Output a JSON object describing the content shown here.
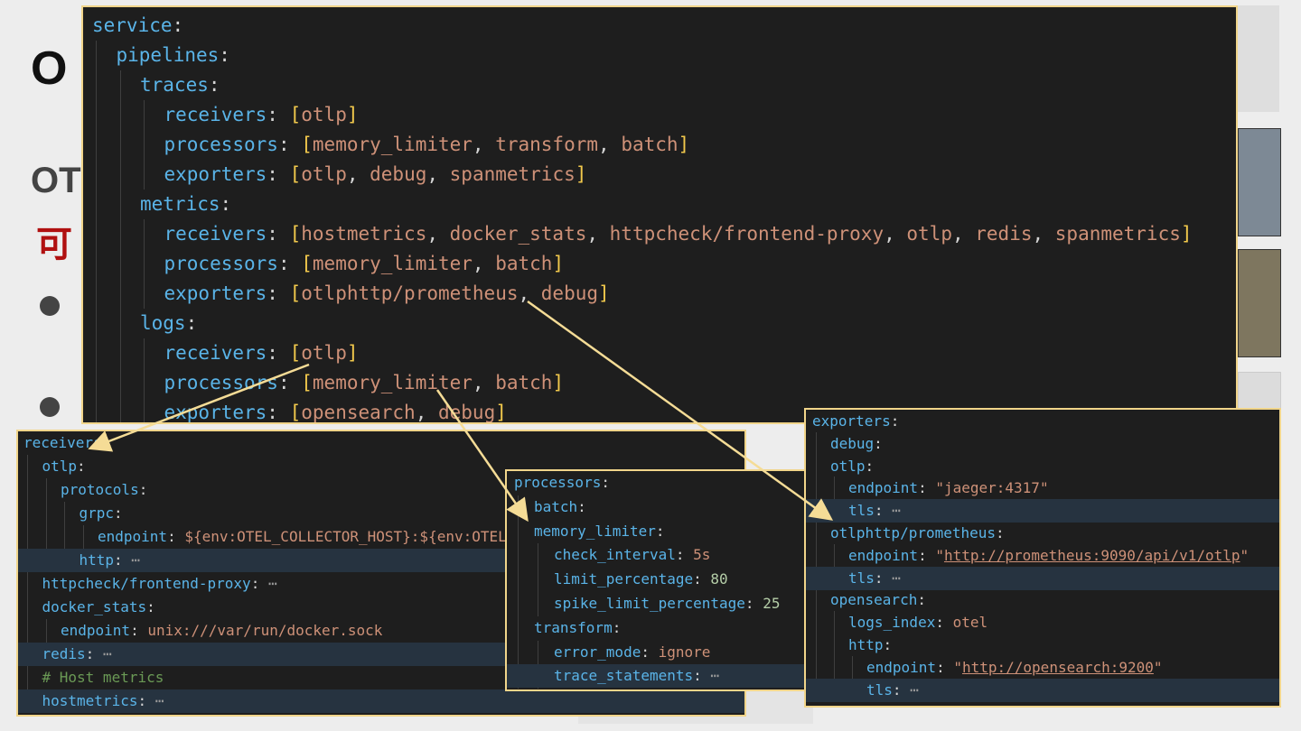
{
  "slide": {
    "title": "O",
    "subtitle_line1": "OT",
    "subtitle_line2": "可"
  },
  "main_config": {
    "lines": [
      {
        "indent": 0,
        "key": "service",
        "tail": ""
      },
      {
        "indent": 1,
        "key": "pipelines",
        "tail": ""
      },
      {
        "indent": 2,
        "key": "traces",
        "tail": ""
      },
      {
        "indent": 3,
        "key": "receivers",
        "items": [
          "otlp"
        ]
      },
      {
        "indent": 3,
        "key": "processors",
        "items": [
          "memory_limiter",
          "transform",
          "batch"
        ]
      },
      {
        "indent": 3,
        "key": "exporters",
        "items": [
          "otlp",
          "debug",
          "spanmetrics"
        ]
      },
      {
        "indent": 2,
        "key": "metrics",
        "tail": ""
      },
      {
        "indent": 3,
        "key": "receivers",
        "items": [
          "hostmetrics",
          "docker_stats",
          "httpcheck/frontend-proxy",
          "otlp",
          "redis",
          "spanmetrics"
        ]
      },
      {
        "indent": 3,
        "key": "processors",
        "items": [
          "memory_limiter",
          "batch"
        ]
      },
      {
        "indent": 3,
        "key": "exporters",
        "items": [
          "otlphttp/prometheus",
          "debug"
        ]
      },
      {
        "indent": 2,
        "key": "logs",
        "tail": ""
      },
      {
        "indent": 3,
        "key": "receivers",
        "items": [
          "otlp"
        ]
      },
      {
        "indent": 3,
        "key": "processors",
        "items": [
          "memory_limiter",
          "batch"
        ]
      },
      {
        "indent": 3,
        "key": "exporters",
        "items": [
          "opensearch",
          "debug"
        ]
      }
    ]
  },
  "receivers_config": {
    "lines": [
      {
        "indent": 0,
        "key": "receivers"
      },
      {
        "indent": 1,
        "key": "otlp"
      },
      {
        "indent": 2,
        "key": "protocols"
      },
      {
        "indent": 3,
        "key": "grpc"
      },
      {
        "indent": 4,
        "key": "endpoint",
        "value": "${env:OTEL_COLLECTOR_HOST}:${env:OTEL_COLLECTOR_PORT_GRPC}",
        "vtype": "v"
      },
      {
        "indent": 3,
        "key": "http",
        "folded": true,
        "hl": true
      },
      {
        "indent": 1,
        "key": "httpcheck/frontend-proxy",
        "folded": true
      },
      {
        "indent": 1,
        "key": "docker_stats"
      },
      {
        "indent": 2,
        "key": "endpoint",
        "value": "unix:///var/run/docker.sock",
        "vtype": "v"
      },
      {
        "indent": 1,
        "key": "redis",
        "folded": true,
        "hl": true
      },
      {
        "indent": 1,
        "comment": "# Host metrics"
      },
      {
        "indent": 1,
        "key": "hostmetrics",
        "folded": true,
        "hl": true
      }
    ]
  },
  "processors_config": {
    "lines": [
      {
        "indent": 0,
        "key": "processors"
      },
      {
        "indent": 1,
        "key": "batch"
      },
      {
        "indent": 1,
        "key": "memory_limiter"
      },
      {
        "indent": 2,
        "key": "check_interval",
        "value": "5s",
        "vtype": "v"
      },
      {
        "indent": 2,
        "key": "limit_percentage",
        "value": "80",
        "vtype": "n"
      },
      {
        "indent": 2,
        "key": "spike_limit_percentage",
        "value": "25",
        "vtype": "n"
      },
      {
        "indent": 1,
        "key": "transform"
      },
      {
        "indent": 2,
        "key": "error_mode",
        "value": "ignore",
        "vtype": "v"
      },
      {
        "indent": 2,
        "key": "trace_statements",
        "folded": true,
        "hl": true
      }
    ]
  },
  "exporters_config": {
    "lines": [
      {
        "indent": 0,
        "key": "exporters"
      },
      {
        "indent": 1,
        "key": "debug"
      },
      {
        "indent": 1,
        "key": "otlp"
      },
      {
        "indent": 2,
        "key": "endpoint",
        "value": "\"jaeger:4317\"",
        "vtype": "v"
      },
      {
        "indent": 2,
        "key": "tls",
        "folded": true,
        "hl": true
      },
      {
        "indent": 1,
        "key": "otlphttp/prometheus"
      },
      {
        "indent": 2,
        "key": "endpoint",
        "value": "http://prometheus:9090/api/v1/otlp",
        "vtype": "url"
      },
      {
        "indent": 2,
        "key": "tls",
        "folded": true,
        "hl": true
      },
      {
        "indent": 1,
        "key": "opensearch"
      },
      {
        "indent": 2,
        "key": "logs_index",
        "value": "otel",
        "vtype": "v"
      },
      {
        "indent": 2,
        "key": "http"
      },
      {
        "indent": 3,
        "key": "endpoint",
        "value": "http://opensearch:9200",
        "vtype": "url"
      },
      {
        "indent": 3,
        "key": "tls",
        "folded": true,
        "hl": true
      }
    ]
  },
  "colors": {
    "editor_bg": "#1e1e1e",
    "border": "#f1d58a",
    "key": "#5ab4e8",
    "string": "#ce9178",
    "number": "#b5cea8",
    "bracket": "#f2c94c",
    "comment": "#6a9955",
    "arrow": "#f5dc96"
  }
}
